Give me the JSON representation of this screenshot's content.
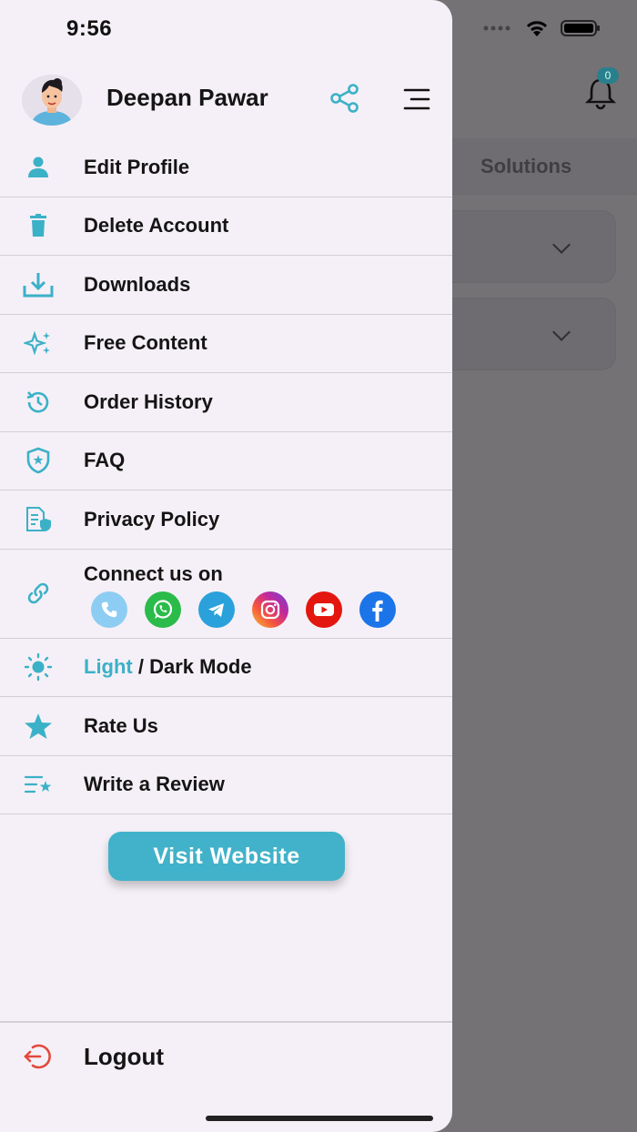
{
  "status_bar": {
    "time": "9:56"
  },
  "background": {
    "tab_label": "Solutions",
    "notification_count": "0"
  },
  "drawer": {
    "user_name": "Deepan Pawar",
    "menu": [
      {
        "label": "Edit Profile",
        "icon": "person-icon"
      },
      {
        "label": "Delete Account",
        "icon": "trash-icon"
      },
      {
        "label": "Downloads",
        "icon": "download-icon"
      },
      {
        "label": "Free Content",
        "icon": "sparkles-icon"
      },
      {
        "label": "Order History",
        "icon": "history-icon"
      },
      {
        "label": "FAQ",
        "icon": "shield-star-icon"
      },
      {
        "label": "Privacy Policy",
        "icon": "document-shield-icon"
      }
    ],
    "connect": {
      "label": "Connect us on",
      "socials": [
        "phone",
        "whatsapp",
        "telegram",
        "instagram",
        "youtube",
        "facebook"
      ]
    },
    "mode": {
      "light": "Light",
      "rest": " / Dark Mode"
    },
    "rate_us": "Rate Us",
    "write_review": "Write a Review",
    "visit_website": "Visit Website",
    "logout": "Logout"
  },
  "colors": {
    "accent": "#3bb1c7",
    "logout_red": "#e2493b",
    "drawer_bg": "#f5f0f7",
    "overlay": "#747275"
  }
}
